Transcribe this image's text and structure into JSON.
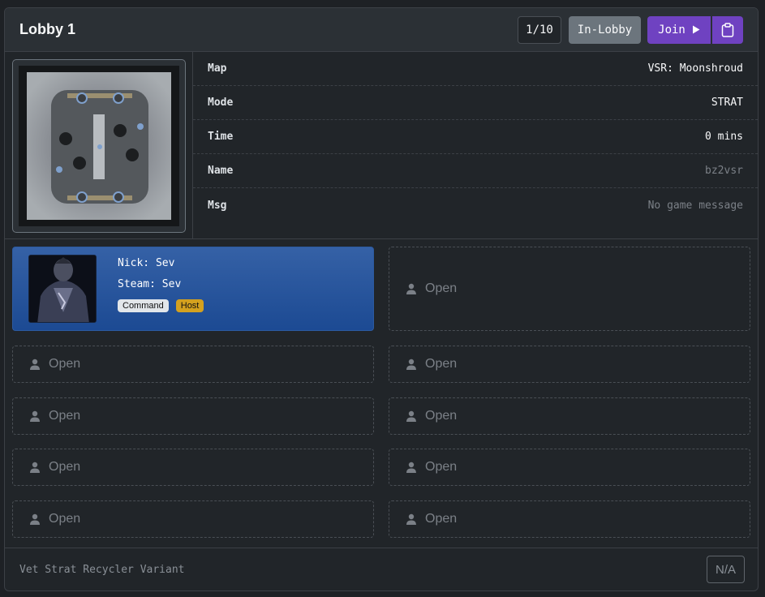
{
  "header": {
    "title": "Lobby 1",
    "player_count": "1/10",
    "status": "In-Lobby",
    "join_label": "Join",
    "join_icon": "play-icon",
    "copy_icon": "clipboard-icon"
  },
  "details": [
    {
      "key": "Map",
      "value": "VSR: Moonshroud"
    },
    {
      "key": "Mode",
      "value": "STRAT"
    },
    {
      "key": "Time",
      "value": "0 mins"
    },
    {
      "key": "Name",
      "value": "bz2vsr"
    },
    {
      "key": "Msg",
      "value": "No game message"
    }
  ],
  "player": {
    "nick": "Nick: Sev",
    "steam": "Steam: Sev",
    "tags": [
      "Command",
      "Host"
    ]
  },
  "open_label": "Open",
  "footer": {
    "description": "Vet Strat Recycler Variant",
    "badge": "N/A"
  },
  "colors": {
    "accent": "#6f42c1",
    "player_card": "#2c5aa0",
    "host_tag": "#d4a11f",
    "status": "#6c757d"
  }
}
